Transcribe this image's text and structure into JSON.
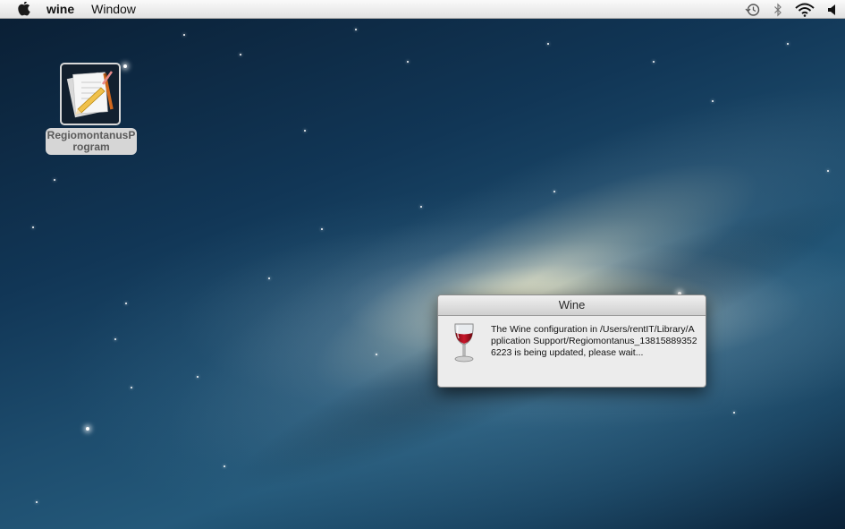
{
  "menubar": {
    "app_name": "wine",
    "window_menu": "Window",
    "icons": [
      "apple-icon",
      "time-machine-icon",
      "bluetooth-icon",
      "wifi-icon",
      "volume-icon"
    ]
  },
  "desktop": {
    "icon": {
      "name": "RegiomontanusProgram",
      "image": "document-pencil-icon"
    }
  },
  "dialog": {
    "title": "Wine",
    "icon": "wine-glass-icon",
    "message": "The Wine configuration in /Users/rentIT/Library/Application Support/Regiomontanus_138158893526223 is being updated, please wait..."
  },
  "colors": {
    "menubar": "#e8e8e8",
    "dialog_bg": "#ececec",
    "wine_red": "#b3121d",
    "icon_label_bg": "#d6d6d6"
  }
}
